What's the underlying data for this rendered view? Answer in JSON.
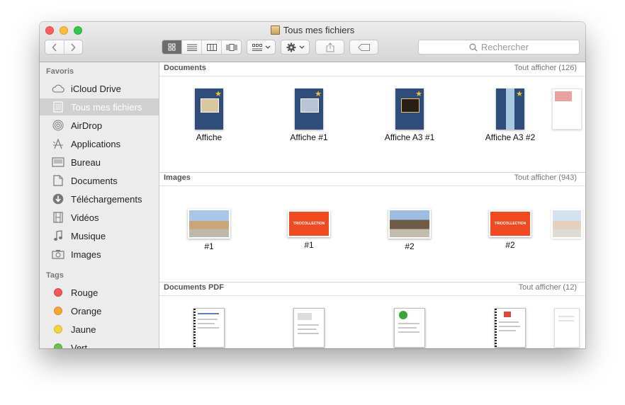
{
  "window": {
    "title": "Tous mes fichiers"
  },
  "toolbar": {
    "back_label": "‹",
    "forward_label": "›",
    "search_placeholder": "Rechercher"
  },
  "sidebar": {
    "favorites_header": "Favoris",
    "favorites": [
      {
        "label": "iCloud Drive",
        "icon": "cloud-icon",
        "selected": false
      },
      {
        "label": "Tous mes fichiers",
        "icon": "all-files-icon",
        "selected": true
      },
      {
        "label": "AirDrop",
        "icon": "airdrop-icon",
        "selected": false
      },
      {
        "label": "Applications",
        "icon": "applications-icon",
        "selected": false
      },
      {
        "label": "Bureau",
        "icon": "desktop-icon",
        "selected": false
      },
      {
        "label": "Documents",
        "icon": "document-icon",
        "selected": false
      },
      {
        "label": "Téléchargements",
        "icon": "download-icon",
        "selected": false
      },
      {
        "label": "Vidéos",
        "icon": "film-icon",
        "selected": false
      },
      {
        "label": "Musique",
        "icon": "music-icon",
        "selected": false
      },
      {
        "label": "Images",
        "icon": "camera-icon",
        "selected": false
      }
    ],
    "tags_header": "Tags",
    "tags": [
      {
        "label": "Rouge",
        "color": "#f0595a"
      },
      {
        "label": "Orange",
        "color": "#f5a53a"
      },
      {
        "label": "Jaune",
        "color": "#f5d33e"
      },
      {
        "label": "Vert",
        "color": "#69c444"
      }
    ]
  },
  "sections": [
    {
      "title": "Documents",
      "show_all": "Tout afficher (126)",
      "items": [
        "Affiche",
        "Affiche #1",
        "Affiche A3 #1",
        "Affiche A3 #2"
      ]
    },
    {
      "title": "Images",
      "show_all": "Tout afficher (943)",
      "items": [
        "#1",
        "#1",
        "#2",
        "#2"
      ],
      "red_banner_text": "TRIOCOLLECTION"
    },
    {
      "title": "Documents PDF",
      "show_all": "Tout afficher (12)",
      "items": []
    }
  ],
  "colors": {
    "selection": "#d0d0d0",
    "poster": "#2e4d7a",
    "red_image": "#f04a23"
  }
}
